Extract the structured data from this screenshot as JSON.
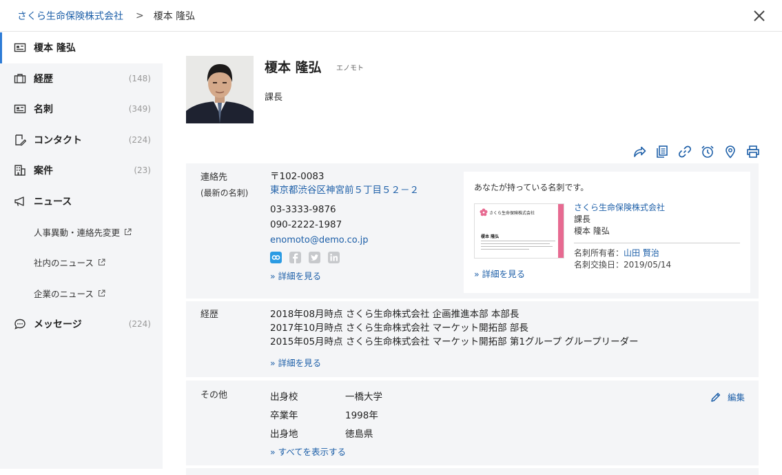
{
  "breadcrumb": {
    "company": "さくら生命保険株式会社",
    "separator": ">",
    "current": "榎本 隆弘"
  },
  "sidebar": {
    "items": [
      {
        "label": "榎本 隆弘",
        "count": "",
        "icon": "id-card-icon"
      },
      {
        "label": "経歴",
        "count": "(148)",
        "icon": "briefcase-icon"
      },
      {
        "label": "名刺",
        "count": "(349)",
        "icon": "business-card-icon"
      },
      {
        "label": "コンタクト",
        "count": "(224)",
        "icon": "contact-edit-icon"
      },
      {
        "label": "案件",
        "count": "(23)",
        "icon": "building-icon"
      },
      {
        "label": "ニュース",
        "count": "",
        "icon": "megaphone-icon"
      }
    ],
    "news_sub": [
      "人事異動・連絡先変更",
      "社内のニュース",
      "企業のニュース"
    ],
    "message": {
      "label": "メッセージ",
      "count": "(224)",
      "icon": "chat-bubble-icon"
    }
  },
  "profile": {
    "name": "榎本 隆弘",
    "kana": "エノモト",
    "title": "課長"
  },
  "contact": {
    "label1": "連絡先",
    "label2": "(最新の名刺)",
    "postal": "〒102-0083",
    "address": "東京都渋谷区神宮前５丁目５２－２",
    "phone1": "03-3333-9876",
    "phone2": "090-2222-1987",
    "email": "enomoto@demo.co.jp",
    "more": "» 詳細を見る"
  },
  "card": {
    "heading": "あなたが持っている名刺です。",
    "thumb_company": "さくら生命保険株式会社",
    "thumb_name": "榎本 隆弘",
    "company": "さくら生命保険株式会社",
    "title": "課長",
    "name": "榎本 隆弘",
    "owner_label": "名刺所有者：",
    "owner": "山田 賢治",
    "exchange": "名刺交換日：2019/05/14",
    "more": "» 詳細を見る"
  },
  "career": {
    "label": "経歴",
    "entries": [
      "2018年08月時点 さくら生命株式会社 企画推進本部 本部長",
      "2017年10月時点 さくら生命株式会社 マーケット開拓部 部長",
      "2015年05月時点 さくら生命株式会社 マーケット開拓部 第1グループ グループリーダー"
    ],
    "more": "» 詳細を見る"
  },
  "other": {
    "label": "その他",
    "rows": [
      {
        "key": "出身校",
        "value": "一橋大学"
      },
      {
        "key": "卒業年",
        "value": "1998年"
      },
      {
        "key": "出身地",
        "value": "徳島県"
      }
    ],
    "more": "» すべてを表示する",
    "edit": "編集"
  },
  "colors": {
    "accent": "#1d5fa8",
    "active_bar": "#2e7cd6",
    "card_stripe": "#e76a91",
    "panel": "#f4f5f7"
  }
}
